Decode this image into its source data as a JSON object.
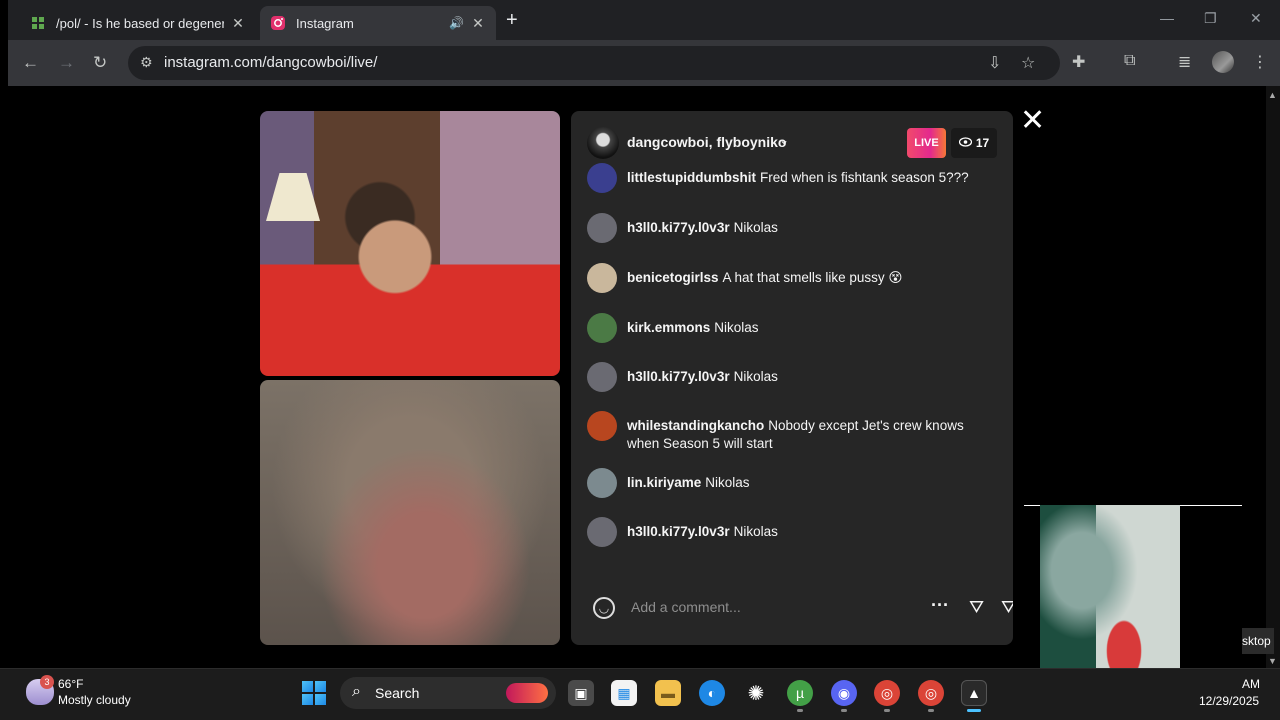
{
  "browser": {
    "tabs": [
      {
        "title": "/pol/ - Is he based or degenera",
        "close": "✕",
        "favicon": "4chan-icon"
      },
      {
        "title": "Instagram",
        "close": "✕",
        "favicon": "instagram-icon",
        "audio": "🔊"
      }
    ],
    "new_tab": "+",
    "window_controls": {
      "minimize": "—",
      "restore": "❐",
      "close": "✕"
    },
    "url": "instagram.com/dangcowboi/live/",
    "nav": {
      "back": "←",
      "forward": "→",
      "reload": "↻"
    },
    "toolbar_icons": {
      "install": "⇩",
      "bookmark": "☆",
      "extensions": "✚",
      "media": "≣",
      "menu": "⋮"
    }
  },
  "live": {
    "hosts": "dangcowboi, flyboyniko",
    "chevron": "⌄",
    "badge": "LIVE",
    "viewers": "17",
    "close": "✕"
  },
  "comments": [
    {
      "user": "littlestupiddumbshit",
      "text": "Fred when is fishtank season 5???",
      "avatar_color": "#3a3f8f"
    },
    {
      "user": "h3ll0.ki77y.l0v3r",
      "text": "Nikolas",
      "avatar_color": "#6a6a72"
    },
    {
      "user": "benicetogirlss",
      "text": "A hat that smells like pussy 😵",
      "avatar_color": "#c9b79c"
    },
    {
      "user": "kirk.emmons",
      "text": "Nikolas",
      "avatar_color": "#4b7a45"
    },
    {
      "user": "h3ll0.ki77y.l0v3r",
      "text": "Nikolas",
      "avatar_color": "#6a6a72"
    },
    {
      "user": "whilestandingkancho",
      "text": "Nobody except Jet's crew knows when Season 5 will start",
      "avatar_color": "#b8461f"
    },
    {
      "user": "lin.kiriyame",
      "text": "Nikolas",
      "avatar_color": "#7c8a8f"
    },
    {
      "user": "h3ll0.ki77y.l0v3r",
      "text": "Nikolas",
      "avatar_color": "#6a6a72"
    }
  ],
  "composer": {
    "placeholder": "Add a comment...",
    "more": "···"
  },
  "taskbar": {
    "weather_temp": "66°F",
    "weather_cond": "Mostly cloudy",
    "weather_badge": "3",
    "search_label": "Search",
    "time": "AM",
    "date": "12/29/2025",
    "desktop_tip": "sktop",
    "apps": [
      {
        "name": "task-view-icon",
        "glyph": "▣",
        "color": "#4a4a4a"
      },
      {
        "name": "microsoft-store-icon",
        "glyph": "▦",
        "color": "#f3f3f3"
      },
      {
        "name": "file-explorer-icon",
        "glyph": "▬",
        "color": "#f2c14e"
      },
      {
        "name": "edge-icon",
        "glyph": "◐",
        "color": "#1e88e5"
      },
      {
        "name": "chatgpt-icon",
        "glyph": "✺",
        "color": "#1c1c1c"
      },
      {
        "name": "utorrent-icon",
        "glyph": "µ",
        "color": "#43a047"
      },
      {
        "name": "discord-icon",
        "glyph": "◉",
        "color": "#5865f2"
      },
      {
        "name": "chrome-icon",
        "glyph": "◎",
        "color": "#db4437"
      },
      {
        "name": "chrome-profile-icon",
        "glyph": "◎",
        "color": "#db4437"
      },
      {
        "name": "obs-icon",
        "glyph": "▲",
        "color": "#2a2a2a"
      }
    ]
  }
}
